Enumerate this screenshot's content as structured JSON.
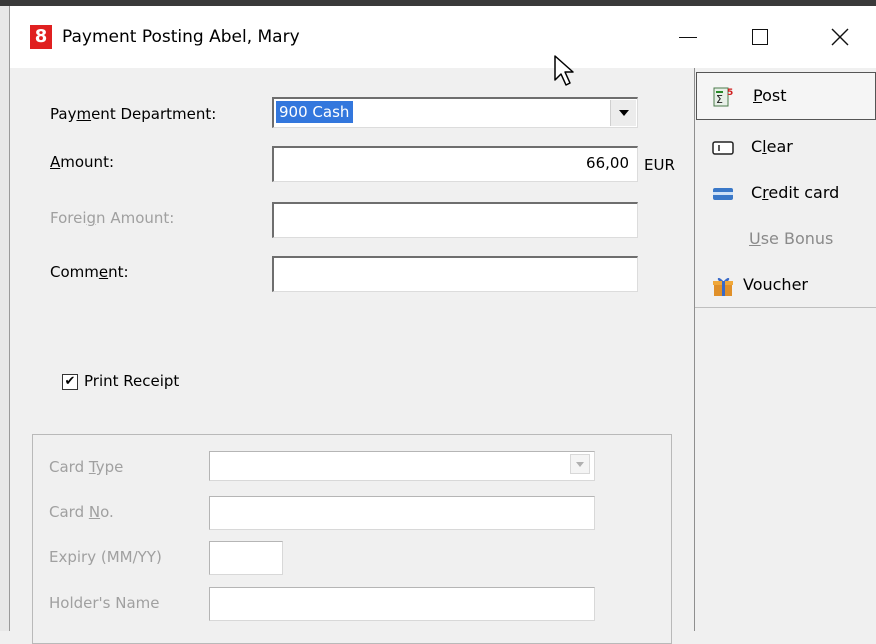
{
  "window": {
    "app_icon_text": "8",
    "title": "Payment Posting Abel, Mary",
    "minimize_symbol": "—",
    "maximize_symbol": "☐",
    "close_symbol": "✕"
  },
  "form": {
    "payment_department": {
      "label_pre": "Pay",
      "label_mn": "m",
      "label_post": "ent Department:",
      "value": "900  Cash"
    },
    "amount": {
      "label_mn": "A",
      "label_post": "mount:",
      "value": "66,00",
      "currency": "EUR"
    },
    "foreign_amount": {
      "label_pre": "Forei",
      "label_mn": "g",
      "label_post": "n Amount:",
      "value": ""
    },
    "comment": {
      "label_pre": "Comm",
      "label_mn": "e",
      "label_post": "nt:",
      "value": ""
    },
    "print_receipt": {
      "label": "Print Receipt",
      "checked": true,
      "check_mark": "✔"
    }
  },
  "card": {
    "card_type": {
      "label_pre": "Card ",
      "label_mn": "T",
      "label_post": "ype",
      "value": ""
    },
    "card_no": {
      "label_pre": "Card ",
      "label_mn": "N",
      "label_post": "o.",
      "value": ""
    },
    "expiry": {
      "label": "Expiry (MM/YY)",
      "value": ""
    },
    "holder": {
      "label": "Holder's Name",
      "value": ""
    }
  },
  "actions": {
    "post": {
      "label_mn": "P",
      "label_post": "ost",
      "icon": "post-icon"
    },
    "clear": {
      "label_pre": "C",
      "label_mn": "l",
      "label_post": "ear",
      "icon": "clear-icon"
    },
    "credit_card": {
      "label_pre": "C",
      "label_mn": "r",
      "label_post": "edit card",
      "icon": "credit-card-icon"
    },
    "use_bonus": {
      "label_mn": "U",
      "label_post": "se Bonus",
      "enabled": false
    },
    "voucher": {
      "label": "Voucher",
      "icon": "gift-icon"
    }
  },
  "colors": {
    "selection": "#3377dd",
    "app_icon": "#e02020",
    "disabled_text": "#a0a0a0"
  }
}
